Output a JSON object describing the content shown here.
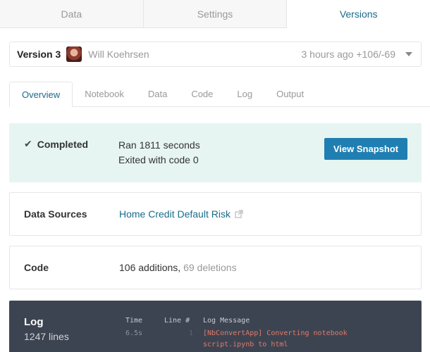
{
  "top_tabs": [
    {
      "label": "Data"
    },
    {
      "label": "Settings"
    },
    {
      "label": "Versions"
    }
  ],
  "version": {
    "label": "Version 3",
    "author": "Will Koehrsen",
    "meta": "3 hours ago +106/-69"
  },
  "sub_tabs": [
    {
      "label": "Overview"
    },
    {
      "label": "Notebook"
    },
    {
      "label": "Data"
    },
    {
      "label": "Code"
    },
    {
      "label": "Log"
    },
    {
      "label": "Output"
    }
  ],
  "status": {
    "label": "Completed",
    "line1": "Ran 1811 seconds",
    "line2": "Exited with code 0",
    "button": "View Snapshot"
  },
  "data_sources": {
    "title": "Data Sources",
    "link": "Home Credit Default Risk"
  },
  "code": {
    "title": "Code",
    "additions": "106 additions",
    "deletions": "69 deletions"
  },
  "log": {
    "title": "Log",
    "count": "1247 lines",
    "headers": {
      "time": "Time",
      "line": "Line #",
      "message": "Log Message"
    },
    "entries": [
      {
        "time": "6.5s",
        "line": "1",
        "message_1": "[NbConvertApp] Converting notebook",
        "message_2": "script.ipynb to html"
      }
    ]
  },
  "colors": {
    "accent": "#1a6b8a",
    "button": "#1f7fb2",
    "status_bg": "#e6f5f1",
    "log_bg": "#3d4451",
    "log_message": "#e07a6a"
  }
}
